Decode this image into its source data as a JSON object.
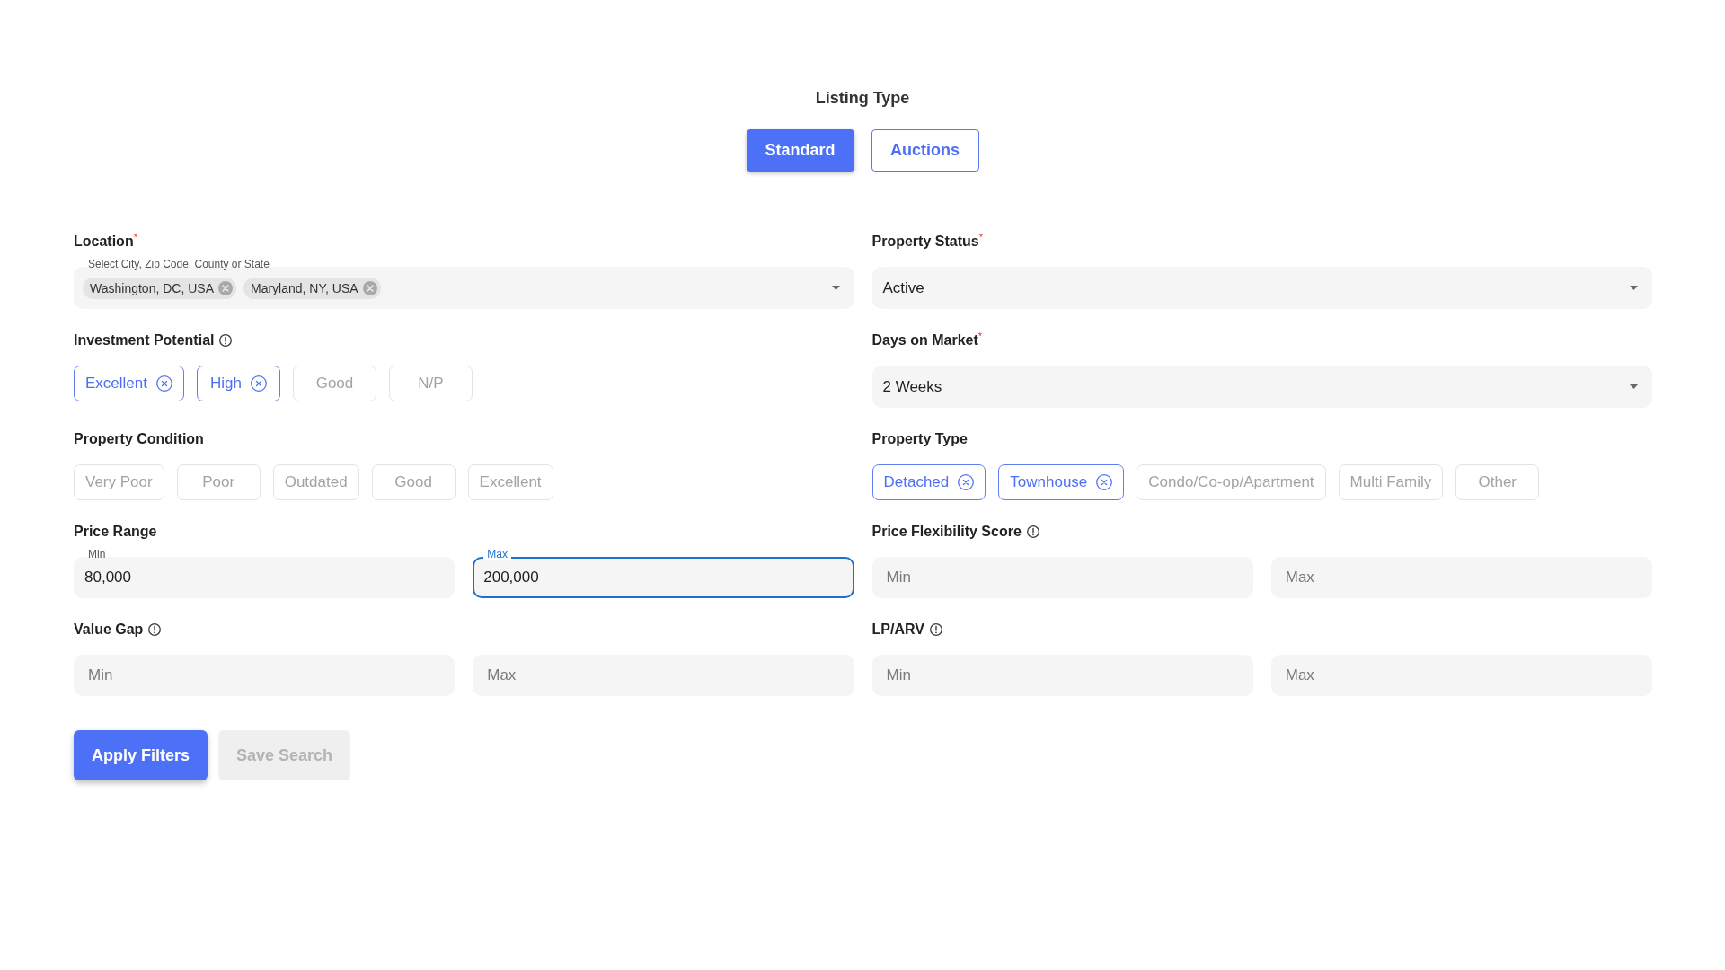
{
  "listing_type": {
    "title": "Listing Type",
    "options": [
      {
        "label": "Standard",
        "selected": true
      },
      {
        "label": "Auctions",
        "selected": false
      }
    ]
  },
  "filters": [
    {
      "kind": "multiselect",
      "label": "Location$^{*}$",
      "info": false,
      "field_label": "Select City, Zip Code, County or State",
      "values": [
        "Washington, DC, USA",
        "Maryland, NY, USA"
      ]
    },
    {
      "kind": "select",
      "label": "Property Status$^{*}$",
      "info": false,
      "value": "Active"
    },
    {
      "kind": "chips",
      "label": "Investment Potential",
      "info": true,
      "chips": [
        {
          "label": "Excellent",
          "selected": true
        },
        {
          "label": "High",
          "selected": true
        },
        {
          "label": "Good",
          "selected": false
        },
        {
          "label": "N/P",
          "selected": false
        }
      ]
    },
    {
      "kind": "select",
      "label": "Days on Market$^{*}$",
      "info": false,
      "value": "2 Weeks"
    },
    {
      "kind": "chips",
      "label": "Property Condition",
      "info": false,
      "chips": [
        {
          "label": "Very Poor",
          "selected": false
        },
        {
          "label": "Poor",
          "selected": false
        },
        {
          "label": "Outdated",
          "selected": false
        },
        {
          "label": "Good",
          "selected": false
        },
        {
          "label": "Excellent",
          "selected": false
        }
      ]
    },
    {
      "kind": "chips",
      "label": "Property Type",
      "info": false,
      "chips": [
        {
          "label": "Detached",
          "selected": true
        },
        {
          "label": "Townhouse",
          "selected": true
        },
        {
          "label": "Condo/Co-op/Apartment",
          "selected": false
        },
        {
          "label": "Multi Family",
          "selected": false
        },
        {
          "label": "Other",
          "selected": false
        }
      ]
    },
    {
      "kind": "range",
      "label": "Price Range",
      "info": false,
      "min": {
        "label": "Min",
        "value": "80,000",
        "focused": false
      },
      "max": {
        "label": "Max",
        "value": "200,000",
        "focused": true
      }
    },
    {
      "kind": "range",
      "label": "Price Flexibility Score",
      "info": true,
      "min": {
        "placeholder": "Min",
        "focused": false
      },
      "max": {
        "placeholder": "Max",
        "focused": false
      }
    },
    {
      "kind": "range",
      "label": "Value Gap",
      "info": true,
      "min": {
        "placeholder": "Min",
        "focused": false
      },
      "max": {
        "placeholder": "Max",
        "focused": false
      }
    },
    {
      "kind": "range",
      "label": "LP/ARV",
      "info": true,
      "min": {
        "placeholder": "Min",
        "focused": false
      },
      "max": {
        "placeholder": "Max",
        "focused": false
      }
    }
  ],
  "actions": [
    {
      "label": "Apply Filters",
      "disabled": false
    },
    {
      "label": "Save Search",
      "disabled": true
    }
  ]
}
